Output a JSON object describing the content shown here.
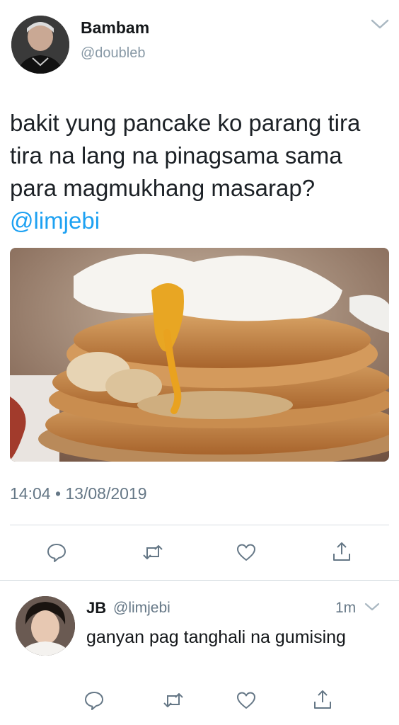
{
  "tweet": {
    "display_name": "Bambam",
    "handle": "@doubleb",
    "text": "bakit yung pancake ko parang tira tira na lang na pinagsama sama para magmukhang masarap? ",
    "mention": "@limjebi",
    "timestamp": "14:04 • 13/08/2019",
    "actions": [
      "reply-icon",
      "retweet-icon",
      "like-icon",
      "share-icon"
    ]
  },
  "reply": {
    "display_name": "JB",
    "handle": "@limjebi",
    "time": "1m",
    "text": "ganyan pag tanghali na gumising",
    "actions": [
      "reply-icon",
      "retweet-icon",
      "like-icon",
      "share-icon"
    ]
  },
  "colors": {
    "mention": "#1da1f2",
    "secondary_text": "#657786",
    "icon": "#657786",
    "divider": "#d8dde2"
  }
}
